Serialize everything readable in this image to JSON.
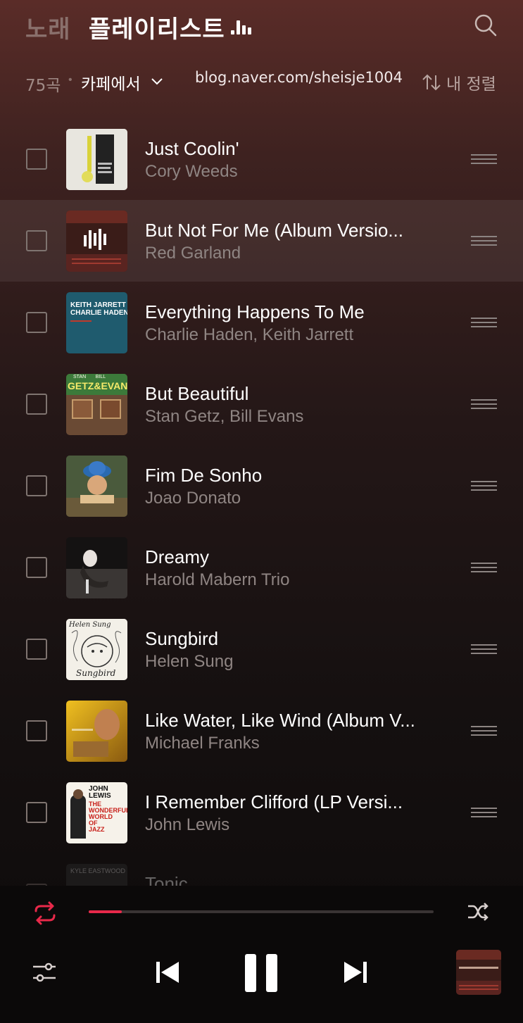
{
  "header": {
    "tab_songs": "노래",
    "tab_playlist": "플레이리스트",
    "search_icon": "search-icon"
  },
  "subbar": {
    "count": "75곡",
    "separator": "•",
    "filter_label": "카페에서",
    "watermark": "blog.naver.com/sheisje1004",
    "sort_label": "내 정렬"
  },
  "tracks": [
    {
      "title": "Just Coolin'",
      "artist": "Cory Weeds"
    },
    {
      "title": "But Not For Me (Album Versio...",
      "artist": "Red Garland",
      "playing": true
    },
    {
      "title": "Everything Happens To Me",
      "artist": "Charlie Haden, Keith Jarrett"
    },
    {
      "title": "But Beautiful",
      "artist": "Stan Getz, Bill Evans"
    },
    {
      "title": "Fim De Sonho",
      "artist": "Joao Donato"
    },
    {
      "title": "Dreamy",
      "artist": "Harold Mabern Trio"
    },
    {
      "title": "Sungbird",
      "artist": "Helen Sung"
    },
    {
      "title": "Like Water, Like Wind (Album V...",
      "artist": "Michael Franks"
    },
    {
      "title": "I Remember Clifford (LP Versi...",
      "artist": "John Lewis"
    },
    {
      "title": "Tonic",
      "artist": ""
    }
  ],
  "album_art_text": {
    "a3_line1": "KEITH JARRETT",
    "a3_line2": "CHARLIE HADEN",
    "a4": "GETZ&EVANS",
    "a4_top": "STAN       BILL",
    "a7": "Helen Sung",
    "a7_bottom": "Sungbird",
    "a9_line1": "JOHN",
    "a9_line2": "LEWIS",
    "a9_line3": "THE",
    "a9_line4": "WONDERFUL",
    "a9_line5": "WORLD",
    "a9_line6": "OF",
    "a9_line7": "JAZZ",
    "a10": "KYLE EASTWOOD"
  },
  "player": {
    "progress": 0.095,
    "accent": "#e8294a"
  }
}
